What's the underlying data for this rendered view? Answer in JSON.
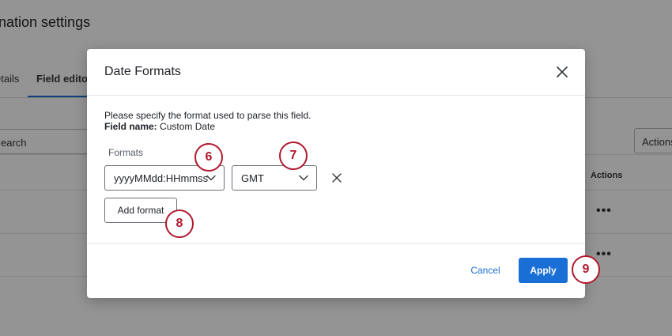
{
  "background": {
    "page_title": "nation settings",
    "tabs": [
      {
        "label": "etails"
      },
      {
        "label": "Field editor"
      }
    ],
    "search_placeholder": "earch",
    "actions_button": "Actions",
    "table_header_actions": "Actions",
    "row_menu": "•••"
  },
  "modal": {
    "title": "Date Formats",
    "description": "Please specify the format used to parse this field.",
    "field_name_label": "Field name:",
    "field_name_value": "Custom Date",
    "formats_label": "Formats",
    "format_select": {
      "value": "yyyyMMdd:HHmmss"
    },
    "timezone_select": {
      "value": "GMT"
    },
    "add_format_label": "Add format",
    "cancel_label": "Cancel",
    "apply_label": "Apply"
  },
  "callouts": [
    "6",
    "7",
    "8",
    "9"
  ],
  "colors": {
    "primary": "#1a6fd6",
    "callout": "#b0182e",
    "overlay": "rgba(0,0,0,0.42)"
  },
  "icons": [
    "close-icon",
    "chevron-down-icon",
    "remove-icon",
    "more-icon"
  ]
}
